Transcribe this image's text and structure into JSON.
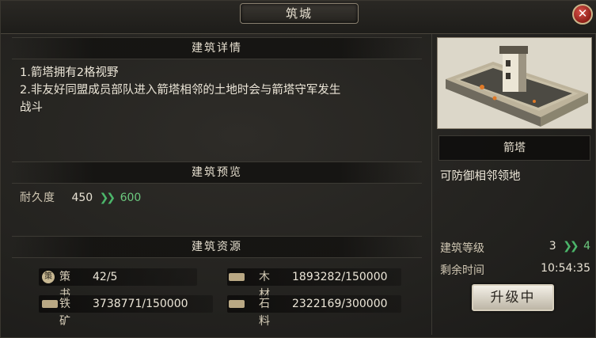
{
  "window": {
    "title": "筑城"
  },
  "details": {
    "header": "建筑详情",
    "lines": [
      "1.箭塔拥有2格视野",
      "2.非友好同盟成员部队进入箭塔相邻的土地时会与箭塔守军发生",
      "战斗"
    ]
  },
  "preview": {
    "header": "建筑预览",
    "durability_label": "耐久度",
    "durability_current": "450",
    "durability_next": "600"
  },
  "resources": {
    "header": "建筑资源",
    "items": [
      {
        "name": "策书",
        "value": "42/5",
        "icon": "book-seal-icon"
      },
      {
        "name": "木材",
        "value": "1893282/150000",
        "icon": "wood-icon"
      },
      {
        "name": "铁矿",
        "value": "3738771/150000",
        "icon": "iron-anvil-icon"
      },
      {
        "name": "石料",
        "value": "2322169/300000",
        "icon": "stone-icon"
      }
    ]
  },
  "building": {
    "name": "箭塔",
    "description": "可防御相邻领地",
    "level_label": "建筑等级",
    "level_current": "3",
    "level_next": "4",
    "time_label": "剩余时间",
    "time_value": "10:54:35",
    "button_label": "升级中"
  },
  "colors": {
    "accent_next": "#6cc97f",
    "close": "#c4362c"
  }
}
